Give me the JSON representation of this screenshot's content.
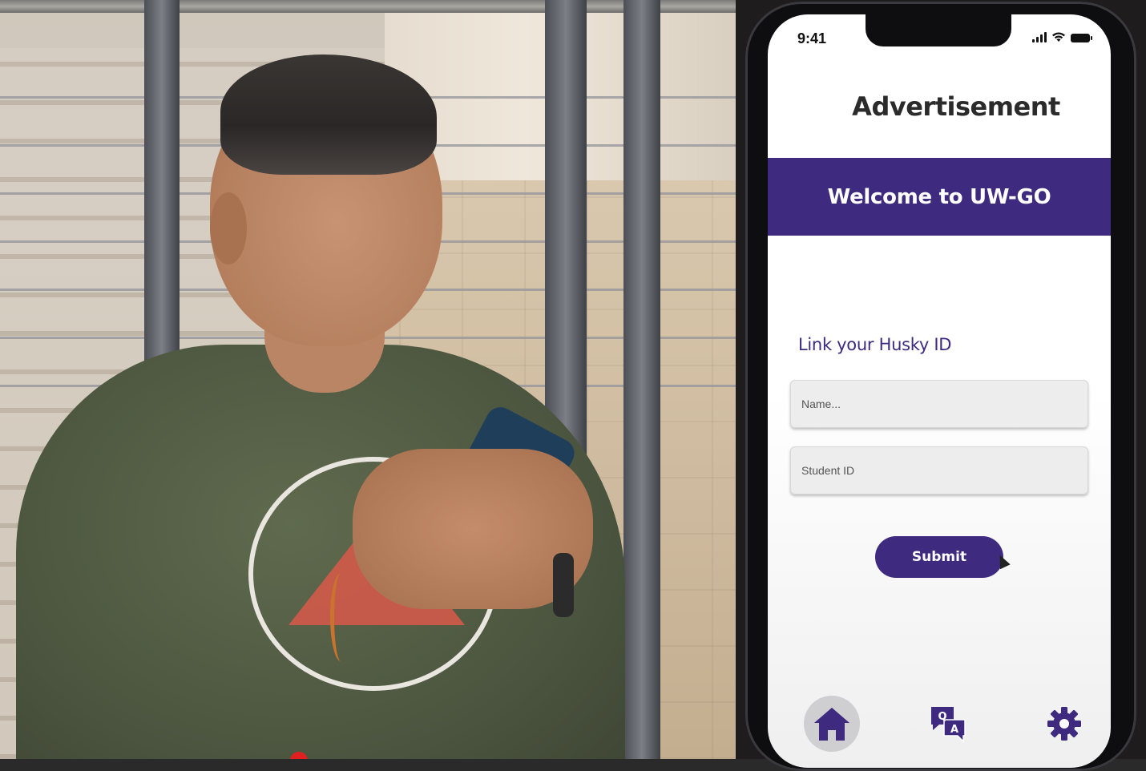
{
  "status_bar": {
    "time": "9:41"
  },
  "header": {
    "title": "Advertisement"
  },
  "banner": {
    "text": "Welcome to UW-GO"
  },
  "form": {
    "label": "Link your Husky ID",
    "name_placeholder": "Name...",
    "student_id_placeholder": "Student ID",
    "submit_label": "Submit"
  },
  "bottom_nav": {
    "items": [
      {
        "icon": "home-icon",
        "active": true
      },
      {
        "icon": "qa-icon",
        "glyph_q": "Q",
        "glyph_a": "A",
        "active": false
      },
      {
        "icon": "gear-icon",
        "active": false
      }
    ]
  },
  "colors": {
    "brand_purple": "#3e2a7e",
    "nav_active_bg": "#cfcfd1",
    "text_dark": "#2b2b2b"
  }
}
